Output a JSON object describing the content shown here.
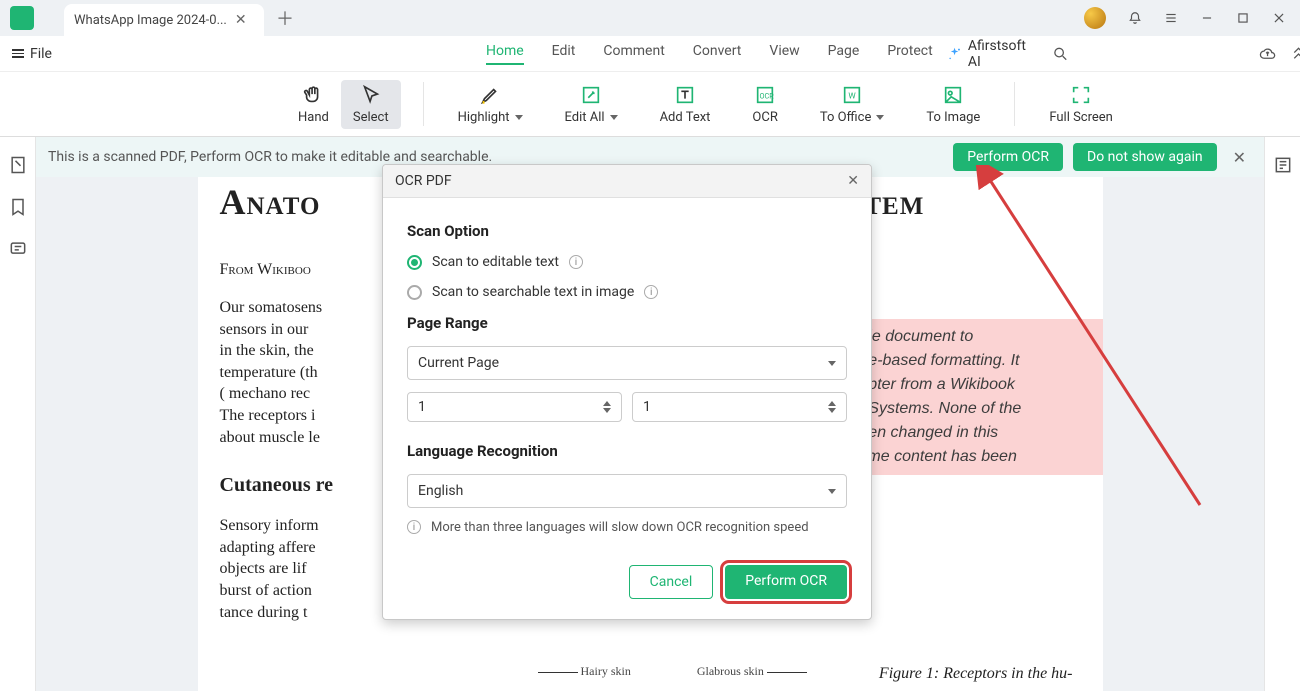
{
  "titlebar": {
    "tab_label": "WhatsApp Image 2024-0..."
  },
  "menubar": {
    "file_label": "File",
    "tabs": [
      {
        "label": "Home",
        "active": true
      },
      {
        "label": "Edit"
      },
      {
        "label": "Comment"
      },
      {
        "label": "Convert"
      },
      {
        "label": "View"
      },
      {
        "label": "Page"
      },
      {
        "label": "Protect"
      }
    ],
    "ai_label": "Afirstsoft AI"
  },
  "toolbar": {
    "hand": "Hand",
    "select": "Select",
    "highlight": "Highlight",
    "edit_all": "Edit All",
    "add_text": "Add Text",
    "ocr": "OCR",
    "to_office": "To Office",
    "to_image": "To Image",
    "full_screen": "Full Screen"
  },
  "infobar": {
    "text": "This is a scanned PDF, Perform OCR to make it editable and searchable.",
    "perform": "Perform OCR",
    "dismiss": "Do not show again"
  },
  "document": {
    "title": "Anato",
    "title_tail": "ystem",
    "sub": "From Wikiboo",
    "body1": "Our somatosens\nsensors in our\nin the skin, the\ntemperature (th\n( mechano rec\nThe receptors i\nabout muscle le",
    "h2": "Cutaneous re",
    "body2": "Sensory inform\nadapting affere\nobjects are lif\nburst of action\ntance during t",
    "pinkbox": "nple document to\nage-based formatting. It\nhapter from a Wikibook\nry Systems. None of the\nbeen changed in this\nsome content has been",
    "caption": "Figure 1:   Receptors in the hu-",
    "fig_left": "Hairy skin",
    "fig_right": "Glabrous skin"
  },
  "modal": {
    "title": "OCR PDF",
    "scan_option_h": "Scan Option",
    "opt1": "Scan to editable text",
    "opt2": "Scan to searchable text in image",
    "page_range_h": "Page Range",
    "page_range_sel": "Current Page",
    "spin_from": "1",
    "spin_to": "1",
    "lang_h": "Language Recognition",
    "lang_sel": "English",
    "lang_hint": "More than three languages will slow down OCR recognition speed",
    "cancel": "Cancel",
    "perform": "Perform OCR"
  }
}
